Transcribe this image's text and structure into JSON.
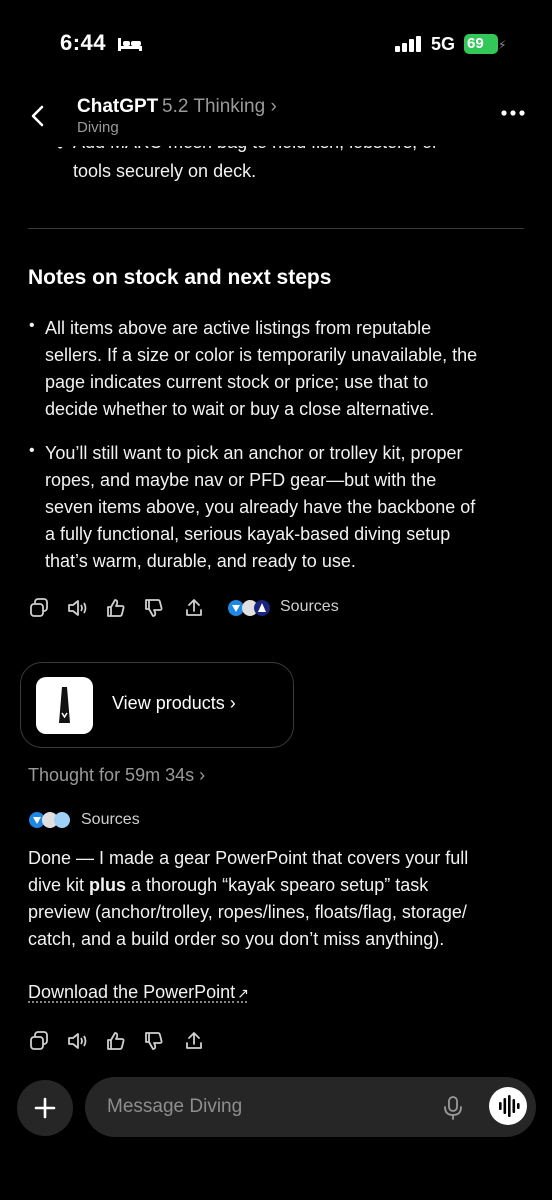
{
  "status_bar": {
    "time": "6:44",
    "network": "5G",
    "battery": "69"
  },
  "header": {
    "title": "ChatGPT",
    "model": "5.2 Thinking",
    "model_chevron": "›",
    "subtitle": "Diving"
  },
  "cut_line": "Add MAKO mesh bag to hold fish, lobsters, or",
  "cut_line_2": "tools securely on deck.",
  "section": {
    "heading": "Notes on stock and next steps",
    "bullets": [
      [
        "All items above are active listings from reputable",
        "sellers. If a size or color is temporarily unavailable, the",
        "page indicates current stock or price; use that to",
        "decide whether to wait or buy a close alternative."
      ],
      [
        "You’ll still want to pick an anchor or trolley kit, proper",
        "ropes, and maybe nav or PFD gear—but with the",
        "seven items above, you already have the backbone of",
        "a fully functional, serious kayak-based diving setup",
        "that’s warm, durable, and ready to use."
      ]
    ]
  },
  "actions": {
    "sources_label": "Sources"
  },
  "products_card": {
    "label": "View products ›"
  },
  "thought": {
    "label": "Thought for 59m 34s ›"
  },
  "sources2": {
    "label": "Sources"
  },
  "message": {
    "line1": "Done — I made a gear PowerPoint that covers your full",
    "line2_pre": "dive kit ",
    "line2_bold": "plus",
    "line2_post": " a thorough “kayak spearo setup” task",
    "line3": "preview (anchor/trolley, ropes/lines, floats/flag, storage/",
    "line4": "catch, and a build order so you don’t miss anything)."
  },
  "download": {
    "label": "Download the PowerPoint",
    "arrow": "↗"
  },
  "composer": {
    "placeholder": "Message Diving"
  }
}
